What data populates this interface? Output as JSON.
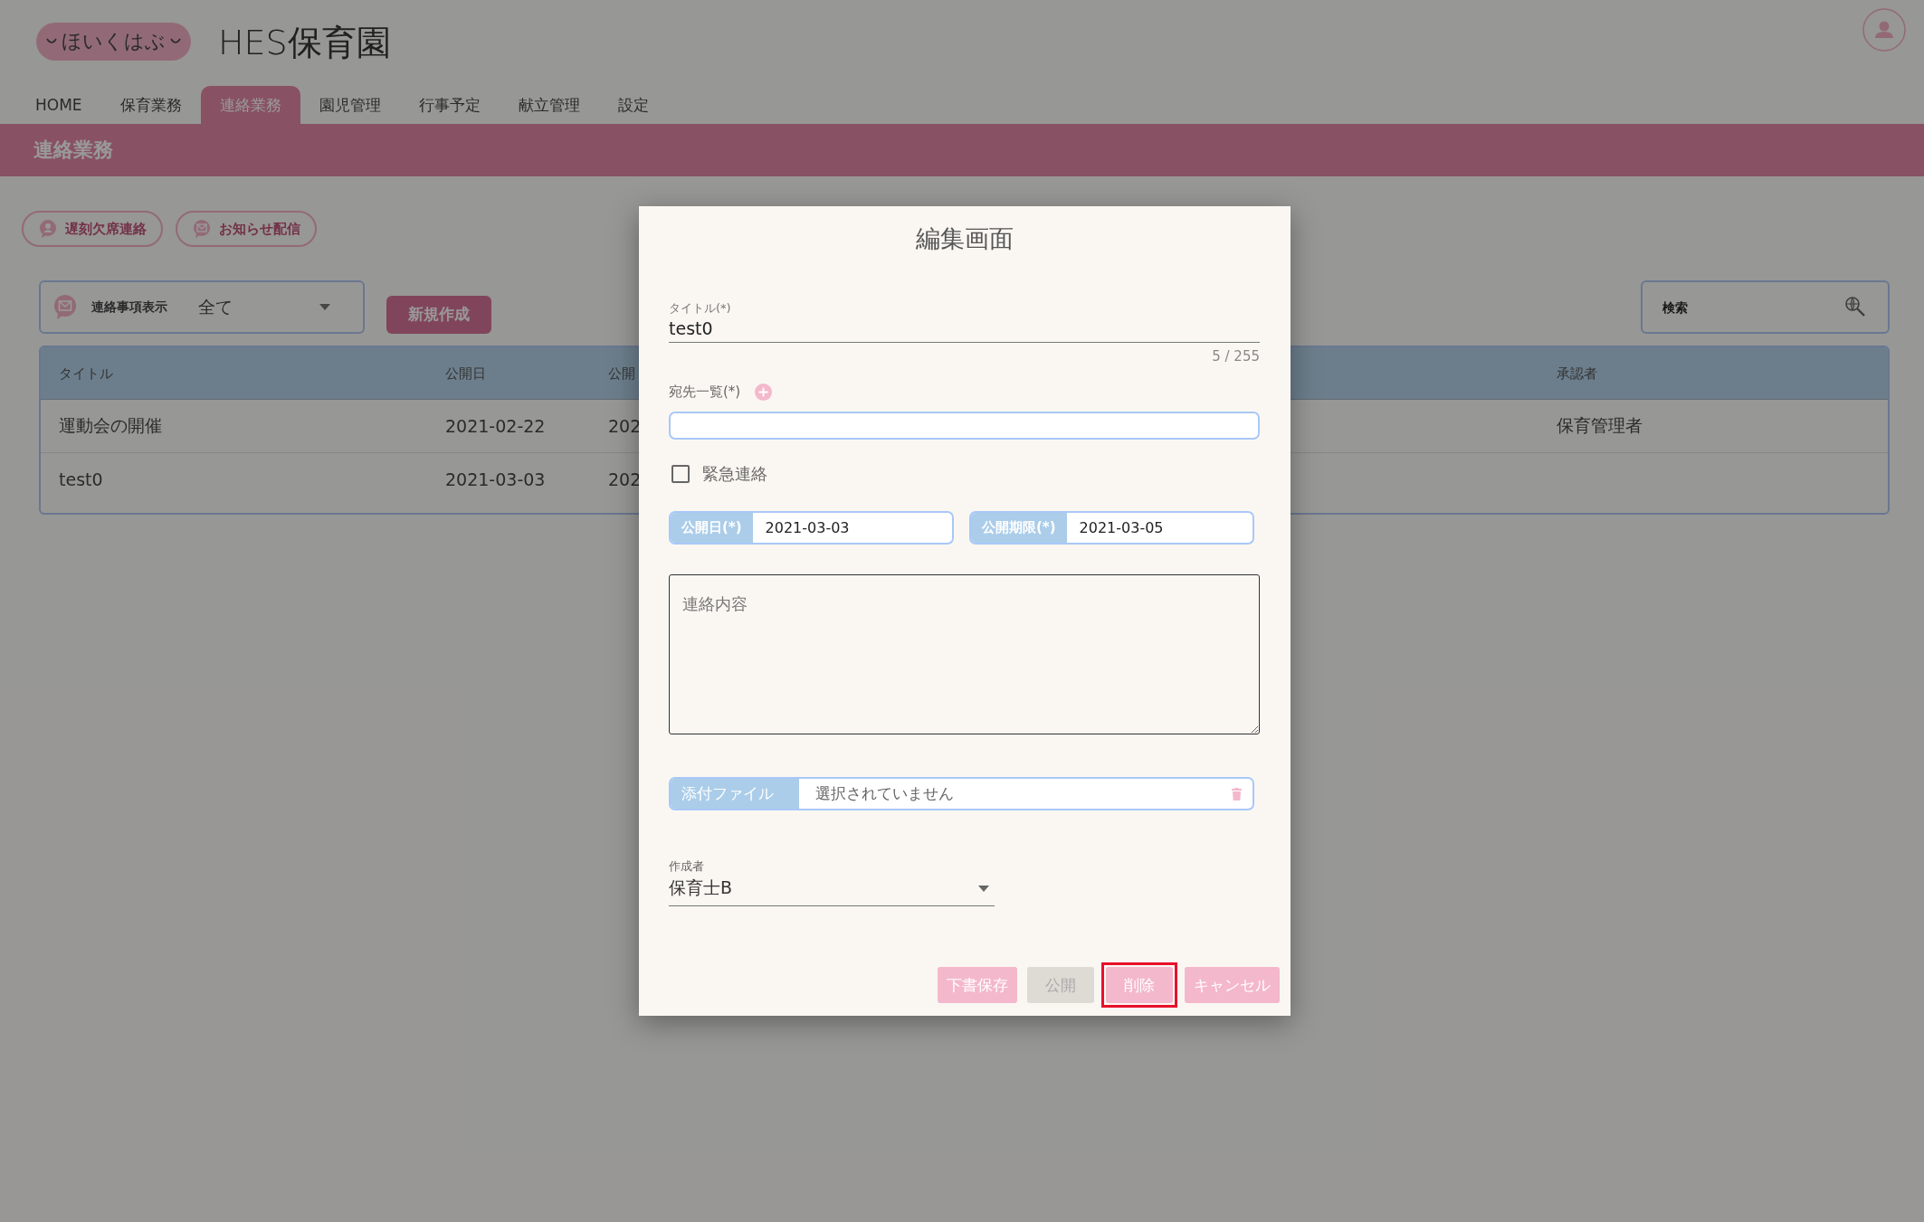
{
  "header": {
    "logo_text": "ほいくはぶ",
    "title": "HES保育園"
  },
  "nav": {
    "tabs": [
      {
        "label": "HOME",
        "selected": false
      },
      {
        "label": "保育業務",
        "selected": false
      },
      {
        "label": "連絡業務",
        "selected": true
      },
      {
        "label": "園児管理",
        "selected": false
      },
      {
        "label": "行事予定",
        "selected": false
      },
      {
        "label": "献立管理",
        "selected": false
      },
      {
        "label": "設定",
        "selected": false
      }
    ]
  },
  "page_title": "連絡業務",
  "actions": [
    {
      "label": "遅刻欠席連絡",
      "kind": "person"
    },
    {
      "label": "お知らせ配信",
      "kind": "mail"
    }
  ],
  "filter": {
    "label": "連絡事項表示",
    "value": "全て"
  },
  "new_button": "新規作成",
  "search": {
    "placeholder": "検索"
  },
  "table": {
    "columns": [
      {
        "label": "タイトル",
        "kind": "wide"
      },
      {
        "label": "公開日",
        "kind": "date"
      },
      {
        "label": "公開",
        "kind": "cut"
      },
      {
        "label": "承認者",
        "kind": "right"
      }
    ],
    "rows": [
      [
        "運動会の開催",
        "2021-02-22",
        "202",
        "保育管理者"
      ],
      [
        "test0",
        "2021-03-03",
        "202",
        ""
      ]
    ]
  },
  "dialog": {
    "title": "編集画面",
    "title_field": {
      "label": "タイトル(*)",
      "value": "test0",
      "counter": "5 / 255"
    },
    "recipients": {
      "label": "宛先一覧(*)"
    },
    "urgent": {
      "label": "緊急連絡",
      "checked": false
    },
    "dates": [
      {
        "label": "公開日(*)",
        "value": "2021-03-03"
      },
      {
        "label": "公開期限(*)",
        "value": "2021-03-05"
      }
    ],
    "content": {
      "placeholder": "連絡内容"
    },
    "attachment": {
      "label": "添付ファイル",
      "value": "選択されていません"
    },
    "author": {
      "label": "作成者",
      "value": "保育士B"
    },
    "buttons": [
      {
        "label": "下書保存",
        "disabled": false,
        "highlighted": false
      },
      {
        "label": "公開",
        "disabled": true,
        "highlighted": false
      },
      {
        "label": "削除",
        "disabled": false,
        "highlighted": true
      },
      {
        "label": "キャンセル",
        "disabled": false,
        "highlighted": false
      }
    ]
  }
}
